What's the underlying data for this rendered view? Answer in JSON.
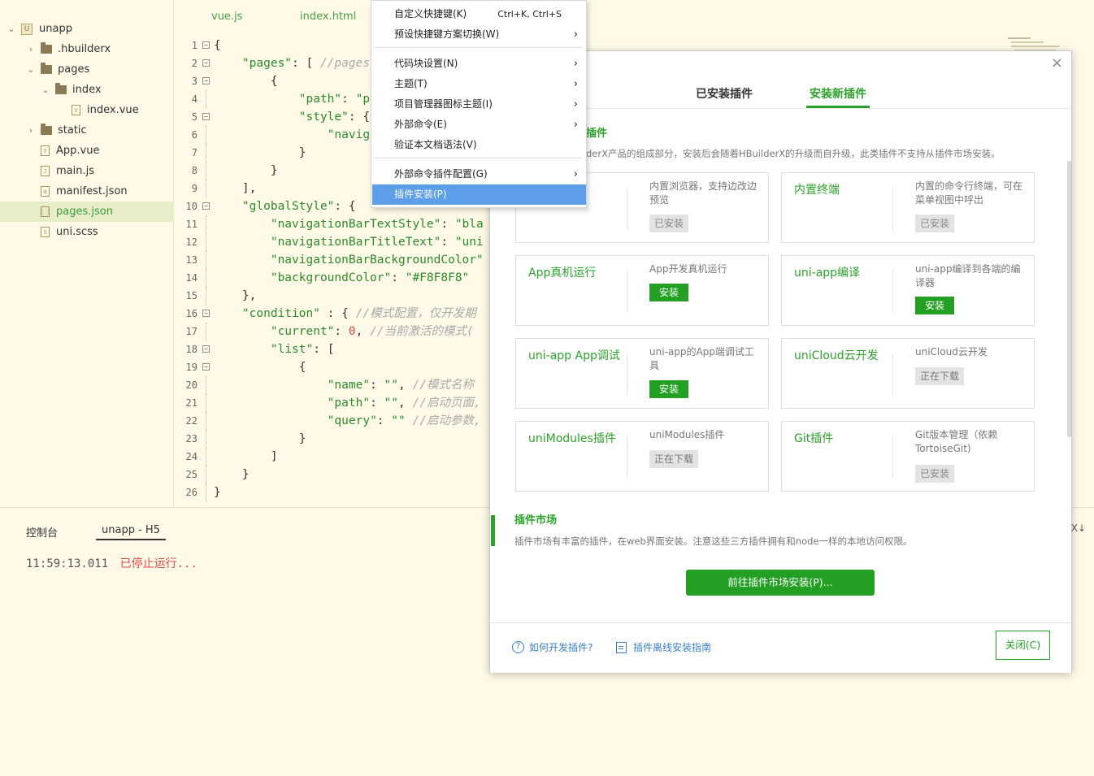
{
  "sidebar": {
    "items": [
      {
        "label": "unapp",
        "kind": "project",
        "icon": "project-icon",
        "chev": "⌄"
      },
      {
        "label": ".hbuilderx",
        "kind": "folder",
        "icon": "folder-icon",
        "chev": "›"
      },
      {
        "label": "pages",
        "kind": "folder",
        "icon": "folder-icon",
        "chev": "⌄"
      },
      {
        "label": "index",
        "kind": "folder",
        "icon": "folder-icon",
        "chev": "⌄"
      },
      {
        "label": "index.vue",
        "kind": "file",
        "icon": "vue-file-icon",
        "glyph": "V"
      },
      {
        "label": "static",
        "kind": "folder",
        "icon": "folder-icon",
        "chev": "›"
      },
      {
        "label": "App.vue",
        "kind": "file",
        "icon": "vue-file-icon",
        "glyph": "V"
      },
      {
        "label": "main.js",
        "kind": "file",
        "icon": "js-file-icon",
        "glyph": "J"
      },
      {
        "label": "manifest.json",
        "kind": "file",
        "icon": "gear-file-icon",
        "glyph": "⚙"
      },
      {
        "label": "pages.json",
        "kind": "file",
        "icon": "json-file-icon",
        "glyph": "[ ]",
        "selected": true
      },
      {
        "label": "uni.scss",
        "kind": "file",
        "icon": "scss-file-icon",
        "glyph": "S"
      }
    ]
  },
  "tabs": [
    "vue.js",
    "index.html"
  ],
  "editor": {
    "line_numbers": [
      "1",
      "2",
      "3",
      "4",
      "5",
      "6",
      "7",
      "8",
      "9",
      "10",
      "11",
      "12",
      "13",
      "14",
      "15",
      "16",
      "17",
      "18",
      "19",
      "20",
      "21",
      "22",
      "23",
      "24",
      "25",
      "26"
    ]
  },
  "context_menu": {
    "items": [
      {
        "label": "自定义快捷键(K)",
        "shortcut": "Ctrl+K, Ctrl+S"
      },
      {
        "label": "预设快捷键方案切换(W)",
        "arrow": "›"
      },
      {
        "label": "代码块设置(N)",
        "arrow": "›"
      },
      {
        "label": "主题(T)",
        "arrow": "›"
      },
      {
        "label": "项目管理器图标主题(I)",
        "arrow": "›"
      },
      {
        "label": "外部命令(E)",
        "arrow": "›"
      },
      {
        "label": "验证本文档语法(V)"
      },
      {
        "label": "外部命令插件配置(G)",
        "arrow": "›"
      },
      {
        "label": "插件安装(P)",
        "highlighted": true
      }
    ]
  },
  "dialog": {
    "close_glyph": "×",
    "tabs": {
      "installed": "已安装插件",
      "install_new": "安装新插件"
    },
    "core_section": {
      "title": "插件",
      "desc": "derX产品的组成部分，安装后会随着HBuilderX的升级而自升级，此类插件不支持从插件市场安装。"
    },
    "cards": [
      {
        "name": "",
        "desc": "内置浏览器，支持边改边预览",
        "state": "已安装",
        "state_type": "installed"
      },
      {
        "name": "内置终端",
        "desc": "内置的命令行终端，可在菜单视图中呼出",
        "state": "已安装",
        "state_type": "installed"
      },
      {
        "name": "App真机运行",
        "desc": "App开发真机运行",
        "state": "安装",
        "state_type": "install"
      },
      {
        "name": "uni-app编译",
        "desc": "uni-app编译到各端的编译器",
        "state": "安装",
        "state_type": "install"
      },
      {
        "name": "uni-app App调试",
        "desc": "uni-app的App端调试工具",
        "state": "安装",
        "state_type": "install"
      },
      {
        "name": "uniCloud云开发",
        "desc": "uniCloud云开发",
        "state": "正在下载",
        "state_type": "downloading"
      },
      {
        "name": "uniModules插件",
        "desc": "uniModules插件",
        "state": "正在下载",
        "state_type": "downloading"
      },
      {
        "name": "Git插件",
        "desc": "Git版本管理（依赖TortoiseGit)",
        "state": "已安装",
        "state_type": "installed"
      }
    ],
    "market": {
      "title": "插件市场",
      "desc": "插件市场有丰富的插件，在web界面安装。注意这些三方插件拥有和node一样的本地访问权限。",
      "button": "前往插件市场安装(P)..."
    },
    "footer": {
      "how_to_dev": "如何开发插件?",
      "offline_guide": "插件离线安装指南",
      "close": "关闭(C)"
    }
  },
  "console": {
    "tabs": [
      "控制台",
      "unapp - H5"
    ],
    "timestamp": "11:59:13.011",
    "message": "已停止运行...",
    "corner_glyph": "X↓"
  },
  "colors": {
    "accent_green": "#23a023",
    "link_blue": "#3a7dc7",
    "menu_highlight": "#5c9ee9",
    "editor_bg": "#fffae8",
    "error_red": "#e04848"
  }
}
